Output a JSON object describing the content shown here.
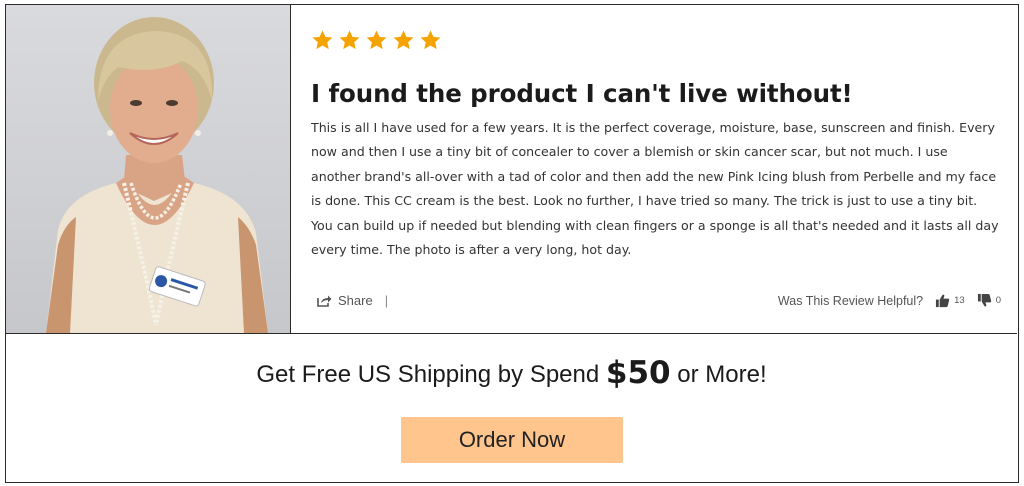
{
  "review": {
    "rating": 5,
    "rating_max": 5,
    "star_color": "#f5a300",
    "photo_alt": "Reviewer photo",
    "title": "I found the product I can't live without!",
    "body": "This is all I have used for a few years. It is the perfect coverage, moisture, base, sunscreen and finish. Every now and then I use a tiny bit of concealer to cover a blemish or skin cancer scar, but not much. I use another brand's all-over with a tad of color and then add the new Pink Icing blush from Perbelle and my face is done. This CC cream is the best. Look no further, I have tried so many. The trick is just to use a tiny bit. You can build up if needed but blending with clean fingers or a sponge is all that's needed and it lasts all day every time. The photo is after a very long, hot day.",
    "share_label": "Share",
    "share_separator": "|",
    "helpful_question": "Was This Review Helpful?",
    "helpful_up_count": "13",
    "helpful_down_count": "0"
  },
  "promo": {
    "shipping_prefix": "Get Free US Shipping by Spend",
    "shipping_amount": "$50",
    "shipping_suffix": "or More!",
    "order_button_label": "Order Now",
    "button_color": "#ffc58c"
  }
}
